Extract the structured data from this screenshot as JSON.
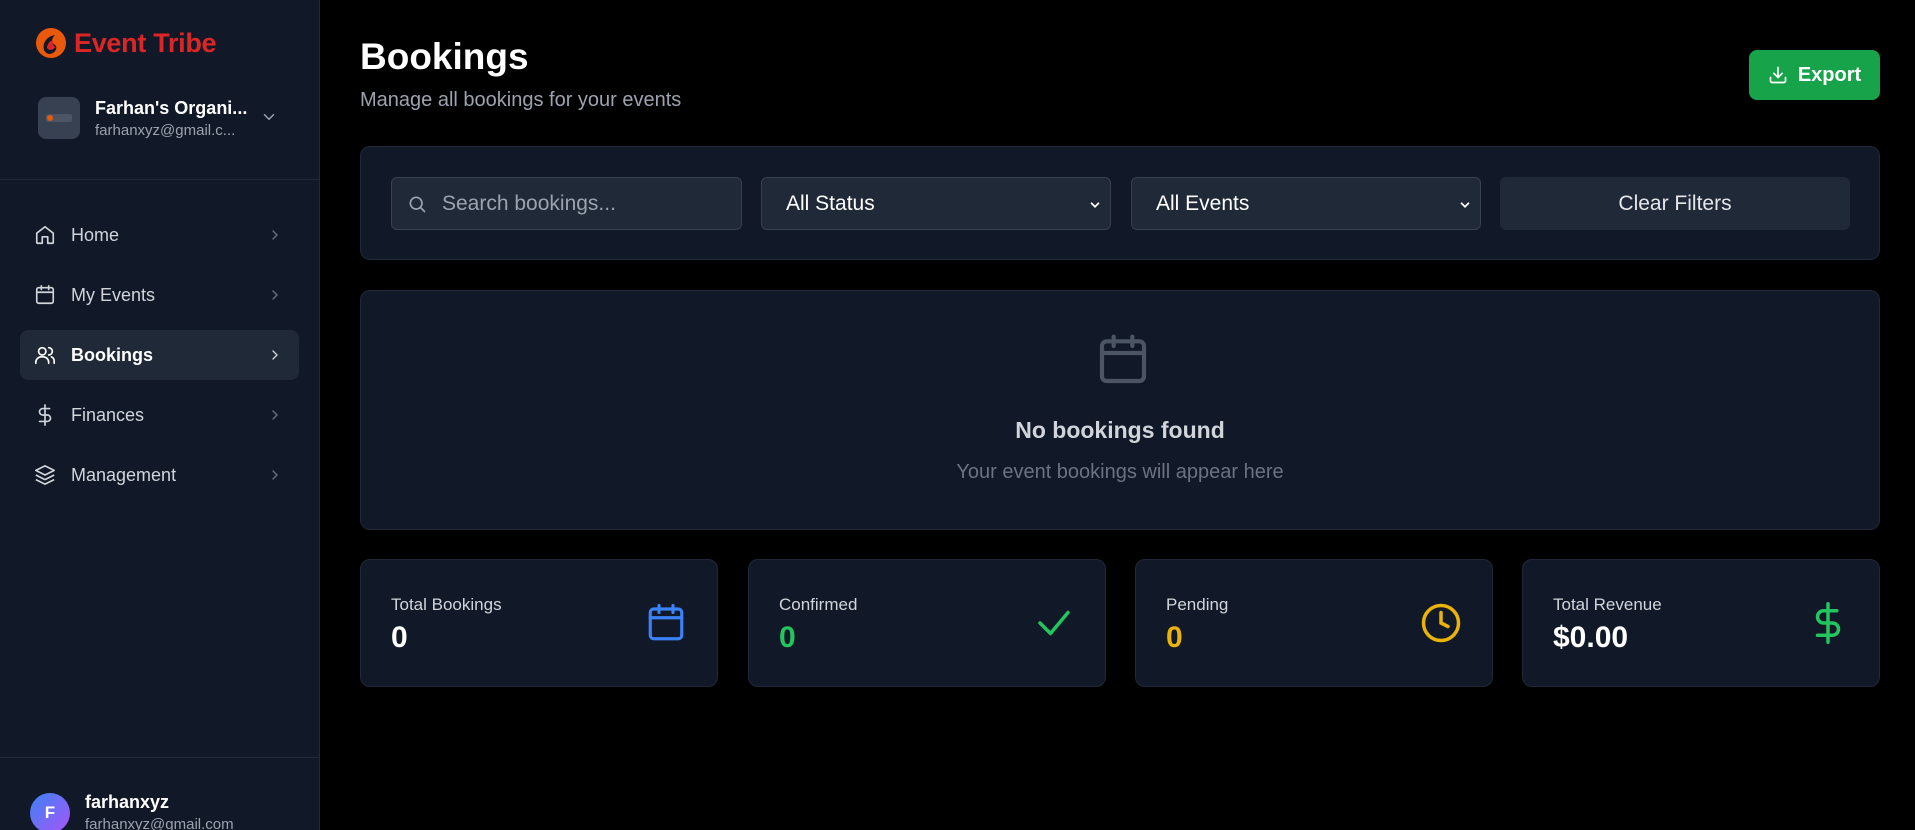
{
  "app": {
    "brand": "Event Tribe"
  },
  "org": {
    "name": "Farhan's Organi...",
    "email": "farhanxyz@gmail.c..."
  },
  "nav": [
    {
      "label": "Home",
      "icon": "home-icon",
      "active": false
    },
    {
      "label": "My Events",
      "icon": "calendar-icon",
      "active": false
    },
    {
      "label": "Bookings",
      "icon": "users-icon",
      "active": true
    },
    {
      "label": "Finances",
      "icon": "dollar-icon",
      "active": false
    },
    {
      "label": "Management",
      "icon": "layers-icon",
      "active": false
    }
  ],
  "user": {
    "initial": "F",
    "name": "farhanxyz",
    "email": "farhanxyz@gmail.com"
  },
  "header": {
    "title": "Bookings",
    "subtitle": "Manage all bookings for your events",
    "export_label": "Export"
  },
  "filters": {
    "search_placeholder": "Search bookings...",
    "status_selected": "All Status",
    "events_selected": "All Events",
    "clear_label": "Clear Filters"
  },
  "empty_state": {
    "title": "No bookings found",
    "subtitle": "Your event bookings will appear here"
  },
  "stats": [
    {
      "label": "Total Bookings",
      "value": "0",
      "icon": "calendar-icon",
      "color": "#3b82f6",
      "value_color": "#ffffff"
    },
    {
      "label": "Confirmed",
      "value": "0",
      "icon": "check-icon",
      "color": "#22c55e",
      "value_color": "#22c55e"
    },
    {
      "label": "Pending",
      "value": "0",
      "icon": "clock-icon",
      "color": "#eab308",
      "value_color": "#eab308"
    },
    {
      "label": "Total Revenue",
      "value": "$0.00",
      "icon": "dollar-icon",
      "color": "#22c55e",
      "value_color": "#ffffff"
    }
  ],
  "colors": {
    "accent": "#16a34a",
    "brand": "#dc2626",
    "panel": "#111827"
  }
}
